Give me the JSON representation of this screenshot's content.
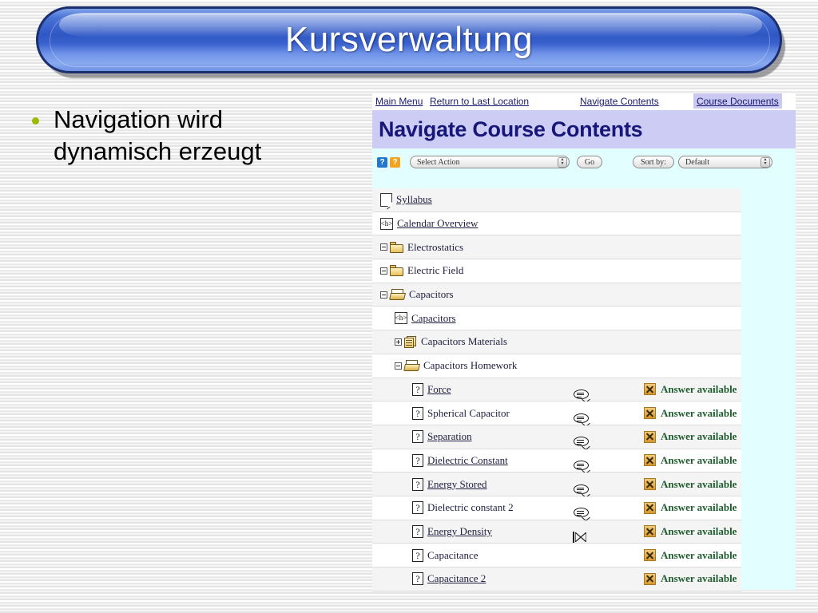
{
  "slide": {
    "title": "Kursverwaltung",
    "bullets": [
      {
        "line1": "Navigation wird",
        "line2": "dynamisch erzeugt",
        "bullet_color": "#9fb800"
      }
    ]
  },
  "screenshot": {
    "navbar": {
      "links": [
        {
          "label": "Main Menu",
          "highlighted": false
        },
        {
          "label": "Return to Last Location",
          "highlighted": false
        },
        {
          "label": "Navigate Contents",
          "highlighted": false
        },
        {
          "label": "Course Documents",
          "highlighted": true
        }
      ]
    },
    "header": {
      "title": "Navigate Course Contents",
      "bg_color": "#ccccf5",
      "text_color": "#17177a"
    },
    "toolbar": {
      "help_icon_blue": "?",
      "help_icon_orange": "?",
      "select_action_value": "Select Action",
      "go_label": "Go",
      "sort_by_label": "Sort by:",
      "sort_value": "Default"
    },
    "tree": {
      "rows": [
        {
          "indent": 0,
          "expander": "none",
          "icon": "page-icon",
          "label": "Syllabus",
          "link": true,
          "mid_icon": "none",
          "answer": null
        },
        {
          "indent": 0,
          "expander": "none",
          "icon": "html-page-icon",
          "label": "Calendar Overview",
          "link": true,
          "mid_icon": "none",
          "answer": null
        },
        {
          "indent": 0,
          "expander": "minus",
          "icon": "folder-icon",
          "label": "Electrostatics",
          "link": false,
          "mid_icon": "none",
          "answer": null
        },
        {
          "indent": 0,
          "expander": "minus",
          "icon": "folder-icon",
          "label": "Electric Field",
          "link": false,
          "mid_icon": "none",
          "answer": null
        },
        {
          "indent": 0,
          "expander": "minus",
          "icon": "folder-open-icon",
          "label": "Capacitors",
          "link": false,
          "mid_icon": "none",
          "answer": null
        },
        {
          "indent": 1,
          "expander": "none",
          "icon": "html-page-icon",
          "label": "Capacitors",
          "link": true,
          "mid_icon": "none",
          "answer": null
        },
        {
          "indent": 1,
          "expander": "plus",
          "icon": "sequence-icon",
          "label": "Capacitors Materials",
          "link": false,
          "mid_icon": "none",
          "answer": null
        },
        {
          "indent": 1,
          "expander": "minus",
          "icon": "folder-open-icon",
          "label": "Capacitors Homework",
          "link": false,
          "mid_icon": "none",
          "answer": null
        },
        {
          "indent": 2,
          "expander": "none",
          "icon": "question-icon",
          "label": "Force",
          "link": true,
          "mid_icon": "discussion-bubble-icon",
          "answer": "Answer available"
        },
        {
          "indent": 2,
          "expander": "none",
          "icon": "question-icon",
          "label": "Spherical Capacitor",
          "link": false,
          "mid_icon": "discussion-bubble-icon",
          "answer": "Answer available"
        },
        {
          "indent": 2,
          "expander": "none",
          "icon": "question-icon",
          "label": "Separation",
          "link": true,
          "mid_icon": "discussion-bubble-icon",
          "answer": "Answer available"
        },
        {
          "indent": 2,
          "expander": "none",
          "icon": "question-icon",
          "label": "Dielectric Constant",
          "link": true,
          "mid_icon": "discussion-bubble-icon",
          "answer": "Answer available"
        },
        {
          "indent": 2,
          "expander": "none",
          "icon": "question-icon",
          "label": "Energy Stored",
          "link": true,
          "mid_icon": "discussion-bubble-icon",
          "answer": "Answer available"
        },
        {
          "indent": 2,
          "expander": "none",
          "icon": "question-icon",
          "label": "Dielectric constant 2",
          "link": false,
          "mid_icon": "discussion-bubble-icon",
          "answer": "Answer available"
        },
        {
          "indent": 2,
          "expander": "none",
          "icon": "question-icon",
          "label": "Energy Density",
          "link": true,
          "mid_icon": "mail-icon",
          "answer": "Answer available"
        },
        {
          "indent": 2,
          "expander": "none",
          "icon": "question-icon",
          "label": "Capacitance",
          "link": false,
          "mid_icon": "none",
          "answer": "Answer available"
        },
        {
          "indent": 2,
          "expander": "none",
          "icon": "question-icon",
          "label": "Capacitance 2",
          "link": true,
          "mid_icon": "none",
          "answer": "Answer available"
        }
      ]
    }
  }
}
